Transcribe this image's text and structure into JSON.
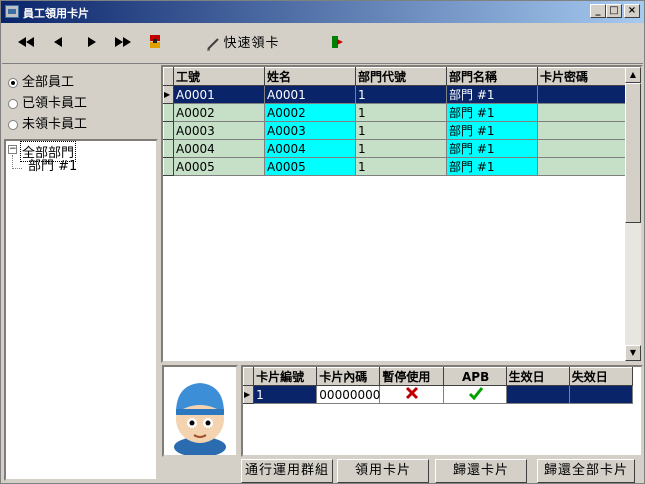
{
  "window": {
    "title": "員工領用卡片"
  },
  "toolbar": {
    "first": "◀◀",
    "prev": "◀",
    "next": "▶",
    "last": "▶▶",
    "quick_label": "快速領卡"
  },
  "filters": [
    {
      "label": "全部員工",
      "selected": true
    },
    {
      "label": "已領卡員工",
      "selected": false
    },
    {
      "label": "未領卡員工",
      "selected": false
    }
  ],
  "tree": {
    "root": "全部部門",
    "child": "部門 #1"
  },
  "employees": {
    "columns": [
      "工號",
      "姓名",
      "部門代號",
      "部門名稱",
      "卡片密碼"
    ],
    "rows": [
      [
        "A0001",
        "A0001",
        "1",
        "部門 #1",
        ""
      ],
      [
        "A0002",
        "A0002",
        "1",
        "部門 #1",
        ""
      ],
      [
        "A0003",
        "A0003",
        "1",
        "部門 #1",
        ""
      ],
      [
        "A0004",
        "A0004",
        "1",
        "部門 #1",
        ""
      ],
      [
        "A0005",
        "A0005",
        "1",
        "部門 #1",
        ""
      ]
    ]
  },
  "cards": {
    "columns": [
      "卡片編號",
      "卡片內碼",
      "暫停使用",
      "APB",
      "生效日",
      "失效日"
    ],
    "rows": [
      {
        "no": "1",
        "inner": "00000000",
        "paused": false,
        "apb": true,
        "start": "",
        "end": ""
      }
    ]
  },
  "buttons": {
    "groups": "通行運用群組",
    "issue": "領用卡片",
    "return": "歸還卡片",
    "return_all": "歸還全部卡片"
  },
  "colors": {
    "title_start": "#0a246a",
    "title_end": "#a6caf0",
    "row_green": "#c6e0c8",
    "cyan": "#00ffff",
    "selected": "#0a246a"
  }
}
